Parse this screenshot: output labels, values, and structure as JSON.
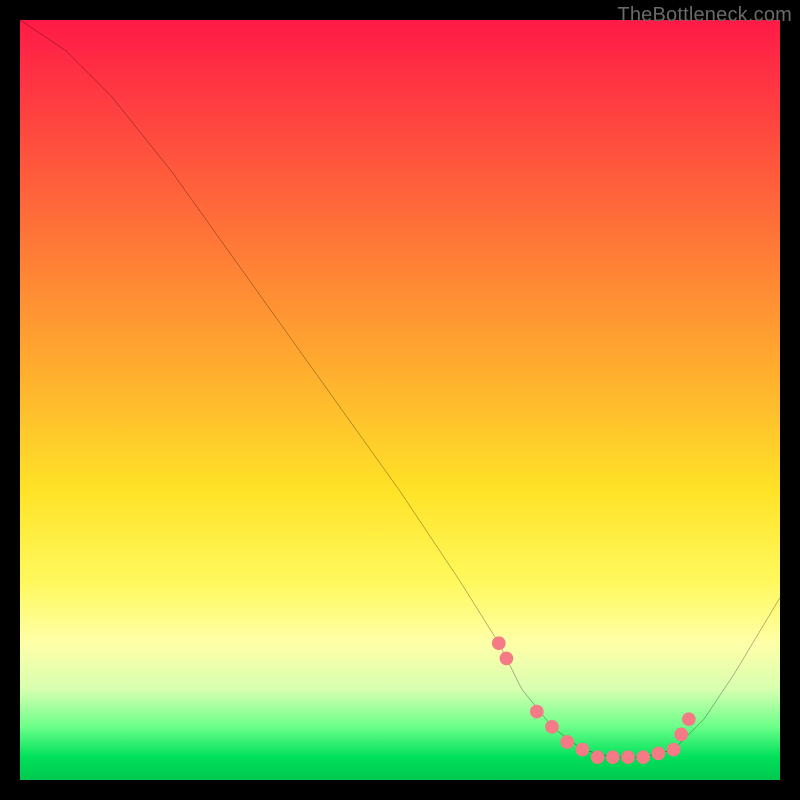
{
  "watermark": "TheBottleneck.com",
  "chart_data": {
    "type": "line",
    "title": "",
    "xlabel": "",
    "ylabel": "",
    "xlim": [
      0,
      100
    ],
    "ylim": [
      0,
      100
    ],
    "grid": false,
    "series": [
      {
        "name": "bottleneck-curve",
        "x": [
          0,
          6,
          12,
          20,
          30,
          40,
          50,
          58,
          63,
          66,
          70,
          74,
          78,
          82,
          86,
          90,
          94,
          100
        ],
        "y": [
          100,
          96,
          90,
          80,
          66,
          52,
          38,
          26,
          18,
          12,
          7,
          4,
          3,
          3,
          4,
          8,
          14,
          24
        ]
      }
    ],
    "markers": {
      "name": "highlight-points",
      "color": "#f47a86",
      "x": [
        63,
        64,
        68,
        70,
        72,
        74,
        76,
        78,
        80,
        82,
        84,
        86,
        87,
        88
      ],
      "y": [
        18,
        16,
        9,
        7,
        5,
        4,
        3,
        3,
        3,
        3,
        3.5,
        4,
        6,
        8
      ]
    },
    "background_gradient": {
      "top": "#ff1a47",
      "upper_mid": "#ffaa2f",
      "mid": "#fff95e",
      "lower_mid": "#d8ffb0",
      "bottom": "#00c850"
    }
  }
}
